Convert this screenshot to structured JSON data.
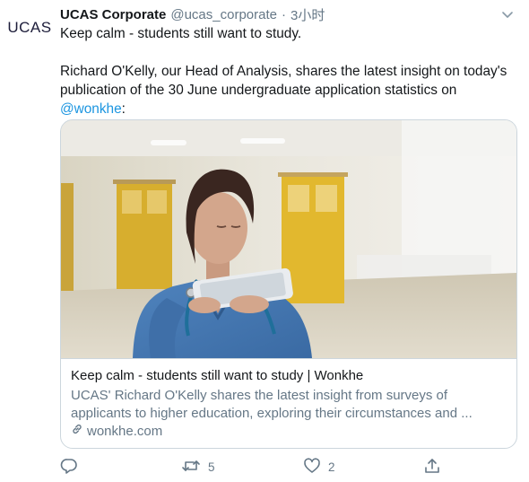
{
  "tweet": {
    "avatar_text": "UCAS",
    "display_name": "UCAS Corporate",
    "handle": "@ucas_corporate",
    "separator": "·",
    "time": "3小时",
    "text_line1": "Keep calm - students still want to study.",
    "text_para2": "Richard O'Kelly, our Head of Analysis, shares the latest insight on today's publication of the 30 June undergraduate application statistics on",
    "mention": "@wonkhe",
    "mention_suffix": ":"
  },
  "card": {
    "image_alt": "Nurse in blue scrubs with a stethoscope reading a tablet in a hospital corridor",
    "title": "Keep calm - students still want to study | Wonkhe",
    "description": "UCAS' Richard O'Kelly shares the latest insight from surveys of applicants to higher education, exploring their circumstances and ...",
    "domain": "wonkhe.com"
  },
  "actions": {
    "reply_count": "",
    "retweet_count": "5",
    "like_count": "2"
  },
  "colors": {
    "link": "#1b95e0",
    "secondary_text": "#657786",
    "border": "#ccd6dd"
  },
  "icons": [
    "caret-down-icon",
    "link-icon",
    "reply-icon",
    "retweet-icon",
    "like-icon",
    "share-icon"
  ]
}
